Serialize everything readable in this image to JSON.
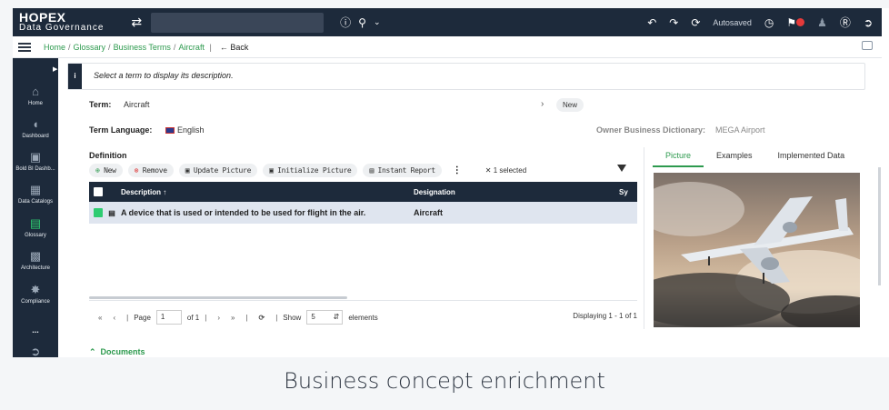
{
  "app": {
    "logo_line1": "HOPEX",
    "logo_line2": "Data Governance",
    "autosaved": "Autosaved"
  },
  "breadcrumb": {
    "home": "Home",
    "glossary": "Glossary",
    "business_terms": "Business Terms",
    "current": "Aircraft",
    "back": "Back"
  },
  "sidebar": {
    "items": [
      {
        "label": "Home",
        "icon": "home-icon"
      },
      {
        "label": "Dashboard",
        "icon": "gauge-icon"
      },
      {
        "label": "Bold BI Dashb...",
        "icon": "bi-icon"
      },
      {
        "label": "Data Catalogs",
        "icon": "catalog-icon"
      },
      {
        "label": "Glossary",
        "icon": "glossary-icon"
      },
      {
        "label": "Architecture",
        "icon": "architecture-icon"
      },
      {
        "label": "Compliance",
        "icon": "compliance-icon"
      },
      {
        "label": "...",
        "icon": "more-icon"
      }
    ]
  },
  "info": {
    "message": "Select a term to display its description."
  },
  "term": {
    "label": "Term:",
    "value": "Aircraft",
    "new_label": "New",
    "language_label": "Term Language:",
    "language_value": "English",
    "owner_label": "Owner Business Dictionary:",
    "owner_value": "MEGA Airport"
  },
  "definition": {
    "label": "Definition",
    "toolbar": {
      "new": "New",
      "remove": "Remove",
      "update_picture": "Update Picture",
      "initialize_picture": "Initialize Picture",
      "instant_report": "Instant Report",
      "selected": "1 selected"
    },
    "columns": [
      "Description",
      "Designation",
      "Sy"
    ],
    "rows": [
      {
        "description": "A device that is used or intended to be used for flight in the air.",
        "designation": "Aircraft"
      }
    ]
  },
  "pager": {
    "page_label": "Page",
    "page_value": "1",
    "of_label": "of 1",
    "show_label": "Show",
    "show_value": "5",
    "elements_label": "elements",
    "displaying": "Displaying 1 - 1 of 1"
  },
  "documents": {
    "label": "Documents"
  },
  "panel": {
    "tabs": [
      "Picture",
      "Examples",
      "Implemented Data"
    ]
  },
  "caption": "Business concept enrichment"
}
